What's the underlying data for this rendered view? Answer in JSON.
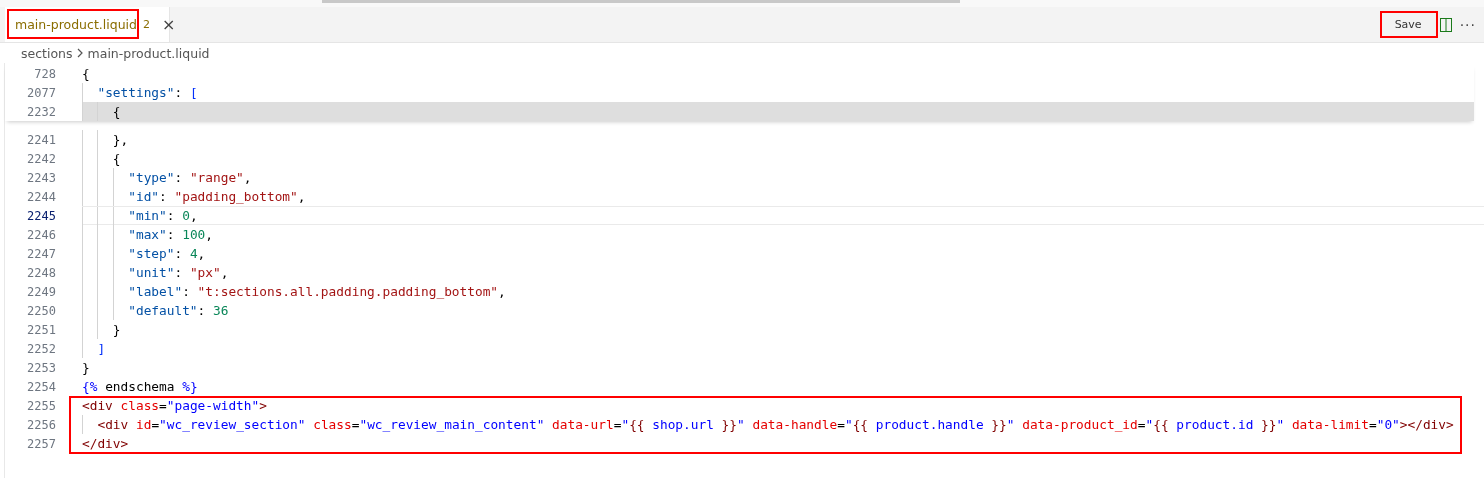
{
  "tabs": [
    {
      "label": "main-product.liquid",
      "badge": "2",
      "close": "×",
      "selected": true,
      "annotated": true
    }
  ],
  "actions": {
    "save": {
      "label": "Save",
      "annotated": true
    },
    "more": "···"
  },
  "breadcrumb": [
    "sections",
    "main-product.liquid"
  ],
  "sticky_lines": [
    {
      "number": "728",
      "hovered": false,
      "tokens": [
        {
          "kind": "p",
          "text": "{"
        }
      ]
    },
    {
      "number": "2077",
      "hovered": false,
      "tokens": [
        {
          "kind": "k",
          "text": "  \"settings\""
        },
        {
          "kind": "p",
          "text": ": "
        },
        {
          "kind": "b",
          "text": "["
        }
      ]
    },
    {
      "number": "2232",
      "hovered": true,
      "tokens": [
        {
          "kind": "p",
          "text": "    {"
        }
      ]
    }
  ],
  "lines": [
    {
      "number": "2241",
      "current": false,
      "tokens": [
        {
          "kind": "p",
          "text": "    },"
        }
      ]
    },
    {
      "number": "2242",
      "current": false,
      "tokens": [
        {
          "kind": "p",
          "text": "    {"
        }
      ]
    },
    {
      "number": "2243",
      "current": false,
      "tokens": [
        {
          "kind": "k",
          "text": "      \"type\""
        },
        {
          "kind": "p",
          "text": ": "
        },
        {
          "kind": "s",
          "text": "\"range\""
        },
        {
          "kind": "p",
          "text": ","
        }
      ]
    },
    {
      "number": "2244",
      "current": false,
      "tokens": [
        {
          "kind": "k",
          "text": "      \"id\""
        },
        {
          "kind": "p",
          "text": ": "
        },
        {
          "kind": "s",
          "text": "\"padding_bottom\""
        },
        {
          "kind": "p",
          "text": ","
        }
      ]
    },
    {
      "number": "2245",
      "current": true,
      "tokens": [
        {
          "kind": "k",
          "text": "      \"min\""
        },
        {
          "kind": "p",
          "text": ": "
        },
        {
          "kind": "n",
          "text": "0"
        },
        {
          "kind": "p",
          "text": ","
        }
      ]
    },
    {
      "number": "2246",
      "current": false,
      "tokens": [
        {
          "kind": "k",
          "text": "      \"max\""
        },
        {
          "kind": "p",
          "text": ": "
        },
        {
          "kind": "n",
          "text": "100"
        },
        {
          "kind": "p",
          "text": ","
        }
      ]
    },
    {
      "number": "2247",
      "current": false,
      "tokens": [
        {
          "kind": "k",
          "text": "      \"step\""
        },
        {
          "kind": "p",
          "text": ": "
        },
        {
          "kind": "n",
          "text": "4"
        },
        {
          "kind": "p",
          "text": ","
        }
      ]
    },
    {
      "number": "2248",
      "current": false,
      "tokens": [
        {
          "kind": "k",
          "text": "      \"unit\""
        },
        {
          "kind": "p",
          "text": ": "
        },
        {
          "kind": "s",
          "text": "\"px\""
        },
        {
          "kind": "p",
          "text": ","
        }
      ]
    },
    {
      "number": "2249",
      "current": false,
      "tokens": [
        {
          "kind": "k",
          "text": "      \"label\""
        },
        {
          "kind": "p",
          "text": ": "
        },
        {
          "kind": "s",
          "text": "\"t:sections.all.padding.padding_bottom\""
        },
        {
          "kind": "p",
          "text": ","
        }
      ]
    },
    {
      "number": "2250",
      "current": false,
      "tokens": [
        {
          "kind": "k",
          "text": "      \"default\""
        },
        {
          "kind": "p",
          "text": ": "
        },
        {
          "kind": "n",
          "text": "36"
        }
      ]
    },
    {
      "number": "2251",
      "current": false,
      "tokens": [
        {
          "kind": "p",
          "text": "    }"
        }
      ]
    },
    {
      "number": "2252",
      "current": false,
      "tokens": [
        {
          "kind": "b",
          "text": "  ]"
        }
      ]
    },
    {
      "number": "2253",
      "current": false,
      "tokens": [
        {
          "kind": "p",
          "text": "}"
        }
      ]
    },
    {
      "number": "2254",
      "current": false,
      "tokens": [
        {
          "kind": "l",
          "text": "{%"
        },
        {
          "kind": "p",
          "text": " endschema "
        },
        {
          "kind": "l",
          "text": "%}"
        }
      ]
    }
  ],
  "annotated_lines": [
    {
      "number": "2255",
      "current": false,
      "tokens": [
        {
          "kind": "t",
          "text": "<div"
        },
        {
          "kind": "a",
          "text": " class"
        },
        {
          "kind": "p",
          "text": "="
        },
        {
          "kind": "v",
          "text": "\"page-width\""
        },
        {
          "kind": "t",
          "text": ">"
        }
      ]
    },
    {
      "number": "2256",
      "current": false,
      "tokens": [
        {
          "kind": "t",
          "text": "  <div"
        },
        {
          "kind": "a",
          "text": " id"
        },
        {
          "kind": "p",
          "text": "="
        },
        {
          "kind": "v",
          "text": "\"wc_review_section\""
        },
        {
          "kind": "a",
          "text": " class"
        },
        {
          "kind": "p",
          "text": "="
        },
        {
          "kind": "v",
          "text": "\"wc_review_main_content\""
        },
        {
          "kind": "a",
          "text": " data-url"
        },
        {
          "kind": "p",
          "text": "="
        },
        {
          "kind": "v",
          "text": "\""
        },
        {
          "kind": "m",
          "text": "{{"
        },
        {
          "kind": "d",
          "text": " shop.url "
        },
        {
          "kind": "m",
          "text": "}}"
        },
        {
          "kind": "v",
          "text": "\""
        },
        {
          "kind": "a",
          "text": " data-handle"
        },
        {
          "kind": "p",
          "text": "="
        },
        {
          "kind": "v",
          "text": "\""
        },
        {
          "kind": "m",
          "text": "{{"
        },
        {
          "kind": "d",
          "text": " product.handle "
        },
        {
          "kind": "m",
          "text": "}}"
        },
        {
          "kind": "v",
          "text": "\""
        },
        {
          "kind": "a",
          "text": " data-product_id"
        },
        {
          "kind": "p",
          "text": "="
        },
        {
          "kind": "v",
          "text": "\""
        },
        {
          "kind": "m",
          "text": "{{"
        },
        {
          "kind": "d",
          "text": " product.id "
        },
        {
          "kind": "m",
          "text": "}}"
        },
        {
          "kind": "v",
          "text": "\""
        },
        {
          "kind": "a",
          "text": " data-limit"
        },
        {
          "kind": "p",
          "text": "="
        },
        {
          "kind": "v",
          "text": "\"0\""
        },
        {
          "kind": "t",
          "text": "></div>"
        }
      ]
    },
    {
      "number": "2257",
      "current": false,
      "tokens": [
        {
          "kind": "t",
          "text": "</div>"
        }
      ]
    }
  ]
}
